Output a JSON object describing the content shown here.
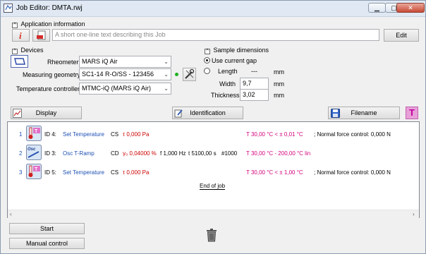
{
  "window": {
    "title": "Job Editor: DMTA.rwj"
  },
  "app_info": {
    "header": "Application information",
    "description_placeholder": "A short one-line text describing this Job",
    "edit_label": "Edit"
  },
  "devices": {
    "header": "Devices",
    "rheometer_label": "Rheometer",
    "rheometer_value": "MARS iQ Air",
    "geometry_label": "Measuring geometry",
    "geometry_value": "SC1-14 R-O/SS - 123456",
    "tc_label": "Temperature controller",
    "tc_value": "MTMC-iQ (MARS iQ Air)"
  },
  "sample": {
    "header": "Sample dimensions",
    "use_gap_label": "Use current gap",
    "length_label": "Length",
    "length_value": "---",
    "width_label": "Width",
    "width_value": "9,7",
    "thickness_label": "Thickness",
    "thickness_value": "3,02",
    "unit": "mm"
  },
  "toolbar": {
    "display_label": "Display",
    "identification_label": "Identification",
    "filename_label": "Filename"
  },
  "steps": [
    {
      "num": "1",
      "id": "ID 4:",
      "name": "Set Temperature",
      "mode": "CS",
      "value": "τ 0,000 Pa",
      "temp": "T 30,00 °C < ± 0,01 °C",
      "extra": "; Normal force control: 0,000 N"
    },
    {
      "num": "2",
      "id": "ID 3:",
      "name": "Osc T-Ramp",
      "mode": "CD",
      "value": "γ₀ 0,04000 %",
      "freq": "f 1,000 Hz",
      "time": "t 5100,00 s",
      "count": "#1000",
      "temp": "T 30,00 °C - 200,00 °C lin"
    },
    {
      "num": "3",
      "id": "ID 5:",
      "name": "Set Temperature",
      "mode": "CS",
      "value": "τ 0,000 Pa",
      "temp": "T 30,00 °C < ± 1,00 °C",
      "extra": "; Normal force control: 0,000 N"
    }
  ],
  "end_of_job": "End of job",
  "footer": {
    "start_label": "Start",
    "manual_label": "Manual control"
  }
}
